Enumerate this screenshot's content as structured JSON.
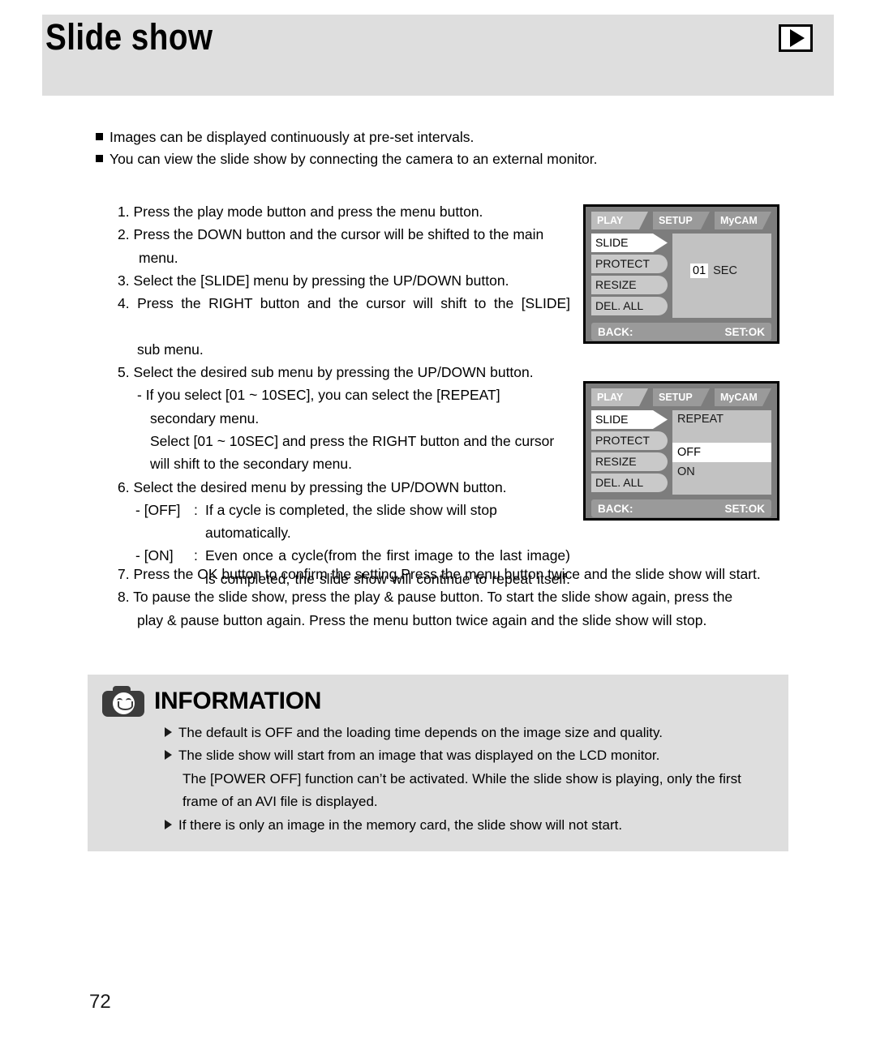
{
  "header": {
    "title": "Slide show",
    "icon": "play-icon"
  },
  "intro_bullets": [
    "Images can be displayed continuously at pre-set intervals.",
    "You can view the slide show by connecting the camera to an external monitor."
  ],
  "steps": {
    "s1": "1. Press the play mode button and press the menu button.",
    "s2": "2. Press the DOWN button and the cursor will be shifted to the main menu.",
    "s3": "3. Select the [SLIDE] menu by pressing the UP/DOWN button.",
    "s4": "4. Press the RIGHT button and the cursor will shift to the [SLIDE]",
    "s4b": "sub menu.",
    "s5": "5. Select the desired sub menu by pressing the UP/DOWN button.",
    "s5a": "- If you select [01 ~ 10SEC], you can select the [REPEAT]",
    "s5b": "secondary menu.",
    "s5c": "Select [01 ~ 10SEC] and press the RIGHT button and the cursor",
    "s5d": "will shift to the secondary menu.",
    "s6": "6. Select the desired menu by pressing the UP/DOWN button.",
    "off_key": "- [OFF]",
    "off_colon": ":",
    "off_val": "If a cycle is completed, the slide show will stop",
    "off_val2": "automatically.",
    "on_key": "- [ON]",
    "on_colon": ":",
    "on_val": "Even once a cycle(from the first image to the last image) is completed, the slide show will continue to repeat itself.",
    "s7": "7. Press the OK button to confirm the setting.Press the menu button twice and the slide show will start.",
    "s8": "8. To pause the slide show, press the play & pause button. To start the slide show again, press the",
    "s8b": "play & pause button again. Press the menu button twice again and the slide show will stop."
  },
  "lcd1": {
    "tabs": [
      {
        "label": "PLAY",
        "active": true
      },
      {
        "label": "SETUP",
        "active": false
      },
      {
        "label": "MyCAM",
        "active": false
      }
    ],
    "menu_items": [
      {
        "label": "SLIDE",
        "selected": true
      },
      {
        "label": "PROTECT",
        "selected": false
      },
      {
        "label": "RESIZE",
        "selected": false
      },
      {
        "label": "DEL. ALL",
        "selected": false
      }
    ],
    "value_number": "01",
    "value_unit": "SEC",
    "footer_left": "BACK:",
    "footer_right": "SET:OK"
  },
  "lcd2": {
    "tabs": [
      {
        "label": "PLAY",
        "active": true
      },
      {
        "label": "SETUP",
        "active": false
      },
      {
        "label": "MyCAM",
        "active": false
      }
    ],
    "menu_items": [
      {
        "label": "SLIDE",
        "selected": true
      },
      {
        "label": "PROTECT",
        "selected": false
      },
      {
        "label": "RESIZE",
        "selected": false
      },
      {
        "label": "DEL. ALL",
        "selected": false
      }
    ],
    "sub_title": "REPEAT",
    "options": [
      {
        "label": "OFF",
        "selected": true
      },
      {
        "label": "ON",
        "selected": false
      }
    ],
    "footer_left": "BACK:",
    "footer_right": "SET:OK"
  },
  "information": {
    "title": "INFORMATION",
    "icon": "camera-smiley-icon",
    "bullets": [
      "The default is OFF and the loading time depends on the image size and quality.",
      "The slide show will start from an image that was displayed on the LCD monitor.",
      "If there is only an image in the memory card, the slide show will not start."
    ],
    "note_line1": "The [POWER OFF] function can’t be activated. While the slide show is playing, only the first",
    "note_line2": "frame of an AVI file is displayed."
  },
  "page_number": "72",
  "colors": {
    "header_bg": "#dedede",
    "info_bg": "#dedede",
    "lcd_bg": "#7d7d7d",
    "lcd_panel": "#c2c2c2",
    "lcd_item": "#c9c9c9",
    "lcd_tab": "#9a9a9a",
    "lcd_tab_active": "#bdbdbd"
  }
}
